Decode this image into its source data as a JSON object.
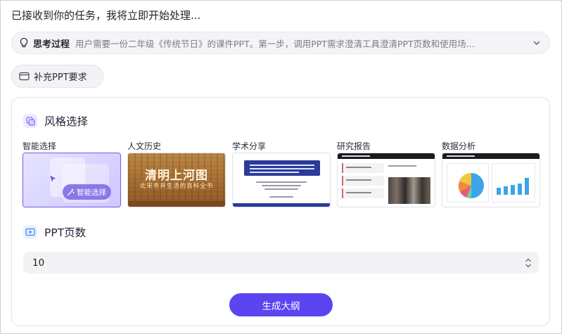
{
  "status_text": "已接收到你的任务，我将立即开始处理...",
  "thinking": {
    "label": "思考过程",
    "text": "用户需要一份二年级《传统节日》的课件PPT。第一步，调用PPT需求澄清工具澄清PPT页数和使用场..."
  },
  "supplement_button": "补充PPT要求",
  "style_section": {
    "title": "风格选择",
    "options": [
      {
        "name": "智能选择",
        "badge": "智能选择",
        "selected": true
      },
      {
        "name": "人文历史",
        "thumb_title": "清明上河图",
        "thumb_subtitle": "北宋市井生活的百科全书"
      },
      {
        "name": "学术分享"
      },
      {
        "name": "研究报告"
      },
      {
        "name": "数据分析"
      }
    ]
  },
  "pages_section": {
    "title": "PPT页数",
    "value": "10"
  },
  "generate_button": "生成大纲",
  "colors": {
    "accent": "#5b45f0",
    "selected_border": "#6b5cf0",
    "icon_bg": "#efe9ff"
  }
}
